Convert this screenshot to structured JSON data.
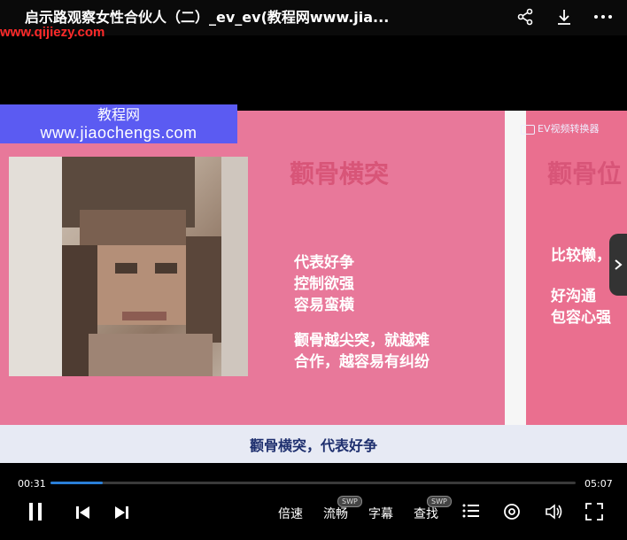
{
  "header": {
    "title": "启示路观察女性合伙人（二）_ev_ev(教程网www.jia...",
    "watermark_url": "www.qijiezy.com"
  },
  "icons": {
    "share": "share-icon",
    "download": "download-icon",
    "more": "more-icon",
    "next": "chevron-right-icon"
  },
  "video": {
    "watermark_line1": "教程网",
    "watermark_line2": "www.jiaochengs.com",
    "ev_logo": "EV视频转换器",
    "slide1": {
      "title": "颧骨横突",
      "lines_a": [
        "代表好争",
        "控制欲强",
        "容易蛮横"
      ],
      "lines_b": [
        "颧骨越尖突，就越难",
        "合作，越容易有纠纷"
      ]
    },
    "slide2": {
      "title": "颧骨位",
      "lines_a": [
        "比较懒，"
      ],
      "lines_b": [
        "好沟通",
        "包容心强"
      ]
    },
    "subtitle": "颧骨横突，代表好争"
  },
  "player": {
    "current_time": "00:31",
    "duration": "05:07",
    "progress": 0.1,
    "speed_label": "倍速",
    "quality_label": "流畅",
    "caption_label": "字幕",
    "search_label": "查找",
    "swp_badge": "SWP"
  },
  "colors": {
    "slide_bg": "#e8789a",
    "progress": "#2a7fd8",
    "watermark_box": "#5b5bf2",
    "watermark_red": "#ff2a2a"
  }
}
